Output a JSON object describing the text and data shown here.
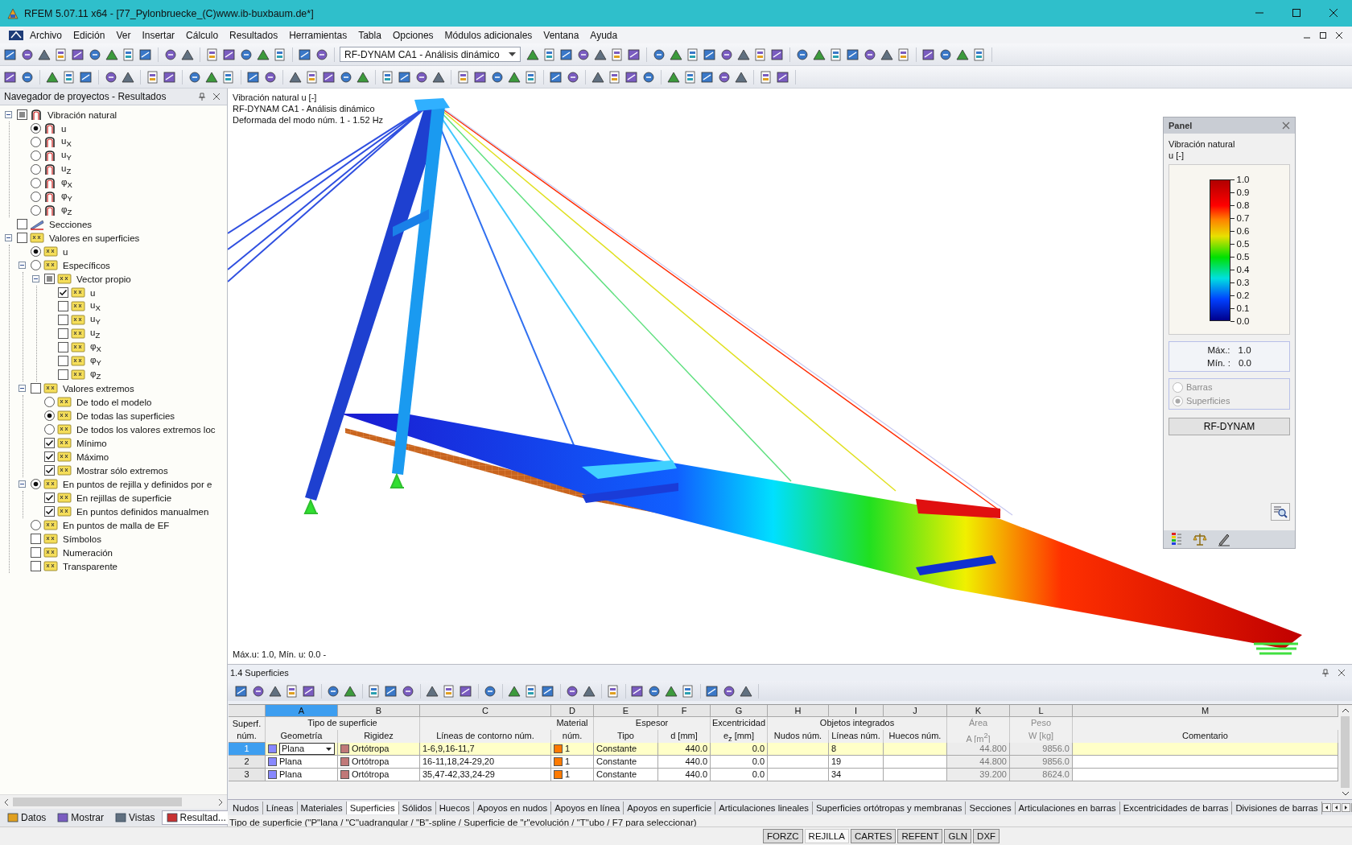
{
  "window": {
    "title": "RFEM 5.07.11 x64 - [77_Pylonbruecke_(C)www.ib-buxbaum.de*]"
  },
  "menu": [
    "Archivo",
    "Edición",
    "Ver",
    "Insertar",
    "Cálculo",
    "Resultados",
    "Herramientas",
    "Tabla",
    "Opciones",
    "Módulos adicionales",
    "Ventana",
    "Ayuda"
  ],
  "toolbar": {
    "load_case": "RF-DYNAM CA1 - Análisis dinámico"
  },
  "navigator": {
    "title": "Navegador de proyectos - Resultados",
    "tree": [
      {
        "label": "Vibración natural",
        "kind": "checkbox",
        "checked": false,
        "partial": true,
        "expanded": true,
        "children": [
          {
            "label": "u",
            "kind": "radio",
            "checked": true
          },
          {
            "label": "u$_{X}$",
            "kind": "radio",
            "checked": false
          },
          {
            "label": "u$_{Y}$",
            "kind": "radio",
            "checked": false
          },
          {
            "label": "u$_{Z}$",
            "kind": "radio",
            "checked": false
          },
          {
            "label": "φ$_{X}$",
            "kind": "radio",
            "checked": false
          },
          {
            "label": "φ$_{Y}$",
            "kind": "radio",
            "checked": false
          },
          {
            "label": "φ$_{Z}$",
            "kind": "radio",
            "checked": false
          }
        ]
      },
      {
        "label": "Secciones",
        "kind": "checkbox",
        "checked": false,
        "partial": false
      },
      {
        "label": "Valores en superficies",
        "kind": "checkbox",
        "checked": false,
        "partial": false,
        "expanded": true,
        "children": [
          {
            "label": "u",
            "kind": "radio",
            "checked": true
          },
          {
            "label": "Específicos",
            "kind": "radio",
            "checked": false,
            "expanded": true,
            "children": [
              {
                "label": "Vector propio",
                "kind": "checkbox",
                "checked": false,
                "partial": true,
                "expanded": true,
                "children": [
                  {
                    "label": "u",
                    "kind": "checkbox",
                    "checked": true,
                    "partial": false
                  },
                  {
                    "label": "u$_{X}$",
                    "kind": "checkbox",
                    "checked": false,
                    "partial": false
                  },
                  {
                    "label": "u$_{Y}$",
                    "kind": "checkbox",
                    "checked": false,
                    "partial": false
                  },
                  {
                    "label": "u$_{Z}$",
                    "kind": "checkbox",
                    "checked": false,
                    "partial": false
                  },
                  {
                    "label": "φ$_{X}$",
                    "kind": "checkbox",
                    "checked": false,
                    "partial": false
                  },
                  {
                    "label": "φ$_{Y}$",
                    "kind": "checkbox",
                    "checked": false,
                    "partial": false
                  },
                  {
                    "label": "φ$_{Z}$",
                    "kind": "checkbox",
                    "checked": false,
                    "partial": false
                  }
                ]
              }
            ]
          },
          {
            "label": "Valores extremos",
            "kind": "checkbox",
            "checked": false,
            "partial": false,
            "expanded": true,
            "children": [
              {
                "label": "De todo el modelo",
                "kind": "radio",
                "checked": false
              },
              {
                "label": "De todas las superficies",
                "kind": "radio",
                "checked": true
              },
              {
                "label": "De todos los valores extremos loc",
                "kind": "radio",
                "checked": false
              },
              {
                "label": "Mínimo",
                "kind": "checkbox",
                "checked": true,
                "partial": false
              },
              {
                "label": "Máximo",
                "kind": "checkbox",
                "checked": true,
                "partial": false
              },
              {
                "label": "Mostrar sólo extremos",
                "kind": "checkbox",
                "checked": true,
                "partial": false
              }
            ]
          },
          {
            "label": "En puntos de rejilla y definidos por e",
            "kind": "radio",
            "checked": true,
            "expanded": true,
            "children": [
              {
                "label": "En rejillas de superficie",
                "kind": "checkbox",
                "checked": true,
                "partial": false
              },
              {
                "label": "En puntos definidos manualmen",
                "kind": "checkbox",
                "checked": true,
                "partial": false
              }
            ]
          },
          {
            "label": "En puntos de malla de EF",
            "kind": "radio",
            "checked": false
          },
          {
            "label": "Símbolos",
            "kind": "checkbox",
            "checked": false,
            "partial": false
          },
          {
            "label": "Numeración",
            "kind": "checkbox",
            "checked": false,
            "partial": false
          },
          {
            "label": "Transparente",
            "kind": "checkbox",
            "checked": false,
            "partial": false
          }
        ]
      }
    ],
    "tabs": [
      {
        "label": "Datos",
        "selected": false
      },
      {
        "label": "Mostrar",
        "selected": false
      },
      {
        "label": "Vistas",
        "selected": false
      },
      {
        "label": "Resultad...",
        "selected": true
      }
    ]
  },
  "viewport": {
    "info": [
      "Vibración natural  u [-]",
      "RF-DYNAM CA1 - Análisis dinámico",
      "Deformada del modo núm. 1 - 1.52 Hz"
    ],
    "footer": "Máx.u: 1.0, Mín. u: 0.0 -"
  },
  "panel": {
    "title": "Panel",
    "heading": "Vibración natural",
    "unit": "u [-]",
    "legend": [
      "1.0",
      "0.9",
      "0.8",
      "0.7",
      "0.6",
      "0.5",
      "0.5",
      "0.4",
      "0.3",
      "0.2",
      "0.1",
      "0.0"
    ],
    "max_label": "Máx.:",
    "max": "1.0",
    "min_label": "Mín. :",
    "min": "0.0",
    "options": [
      {
        "label": "Barras",
        "selected": false
      },
      {
        "label": "Superficies",
        "selected": true
      }
    ],
    "options_disabled": true,
    "button": "RF-DYNAM"
  },
  "table": {
    "title": "1.4 Superficies",
    "corner": [
      "Superf.",
      "núm."
    ],
    "header": [
      {
        "label": "Tipo de superficie",
        "columns": [
          {
            "letter": "A",
            "label": "Geometría",
            "selected": true,
            "greyed": false
          },
          {
            "letter": "B",
            "label": "Rigidez",
            "selected": false,
            "greyed": false
          }
        ]
      },
      {
        "columns": [
          {
            "letter": "C",
            "label": "Líneas de contorno núm.",
            "selected": false,
            "greyed": false
          }
        ]
      },
      {
        "label": "Material",
        "columns": [
          {
            "letter": "D",
            "label": "núm.",
            "selected": false,
            "greyed": false
          }
        ]
      },
      {
        "label": "Espesor",
        "columns": [
          {
            "letter": "E",
            "label": "Tipo",
            "selected": false,
            "greyed": false
          },
          {
            "letter": "F",
            "label": "d [mm]",
            "selected": false,
            "greyed": false
          }
        ]
      },
      {
        "label": "Excentricidad",
        "columns": [
          {
            "letter": "G",
            "label": "e$_{z}$ [mm]",
            "selected": false,
            "greyed": false
          }
        ]
      },
      {
        "label": "Objetos integrados",
        "columns": [
          {
            "letter": "H",
            "label": "Nudos núm.",
            "selected": false,
            "greyed": false
          },
          {
            "letter": "I",
            "label": "Líneas núm.",
            "selected": false,
            "greyed": false
          },
          {
            "letter": "J",
            "label": "Huecos núm.",
            "selected": false,
            "greyed": false
          }
        ]
      },
      {
        "label": "Área",
        "columns": [
          {
            "letter": "K",
            "label": "A [m$^{2}$]",
            "selected": false,
            "greyed": true
          }
        ]
      },
      {
        "label": "Peso",
        "columns": [
          {
            "letter": "L",
            "label": "W [kg]",
            "selected": false,
            "greyed": true
          }
        ]
      },
      {
        "columns": [
          {
            "letter": "M",
            "label": "Comentario",
            "selected": false,
            "greyed": false
          }
        ]
      }
    ],
    "rows": [
      {
        "num": "1",
        "selected": true,
        "cells": {
          "A": "Plana",
          "B": "Ortótropa",
          "C": "1-6,9,16-11,7",
          "D": "1",
          "E": "Constante",
          "F": "440.0",
          "G": "0.0",
          "I": "8",
          "K": "44.800",
          "L": "9856.0"
        }
      },
      {
        "num": "2",
        "selected": false,
        "cells": {
          "A": "Plana",
          "B": "Ortótropa",
          "C": "16-11,18,24-29,20",
          "D": "1",
          "E": "Constante",
          "F": "440.0",
          "G": "0.0",
          "I": "19",
          "K": "44.800",
          "L": "9856.0"
        }
      },
      {
        "num": "3",
        "selected": false,
        "cells": {
          "A": "Plana",
          "B": "Ortótropa",
          "C": "35,47-42,33,24-29",
          "D": "1",
          "E": "Constante",
          "F": "440.0",
          "G": "0.0",
          "I": "34",
          "K": "39.200",
          "L": "8624.0"
        }
      }
    ]
  },
  "sheet_tabs": [
    {
      "label": "Nudos",
      "selected": false
    },
    {
      "label": "Líneas",
      "selected": false
    },
    {
      "label": "Materiales",
      "selected": false
    },
    {
      "label": "Superficies",
      "selected": true
    },
    {
      "label": "Sólidos",
      "selected": false
    },
    {
      "label": "Huecos",
      "selected": false
    },
    {
      "label": "Apoyos en nudos",
      "selected": false
    },
    {
      "label": "Apoyos en línea",
      "selected": false
    },
    {
      "label": "Apoyos en superficie",
      "selected": false
    },
    {
      "label": "Articulaciones lineales",
      "selected": false
    },
    {
      "label": "Superficies ortótropas y membranas",
      "selected": false
    },
    {
      "label": "Secciones",
      "selected": false
    },
    {
      "label": "Articulaciones en barras",
      "selected": false
    },
    {
      "label": "Excentricidades de barras",
      "selected": false
    },
    {
      "label": "Divisiones de barras",
      "selected": false
    }
  ],
  "hint": "Tipo de superficie (\"P\"lana / \"C\"uadrangular / \"B\"-spline / Superficie de \"r\"evolución  / \"T\"ubo / F7 para seleccionar)",
  "status_buttons": [
    {
      "label": "FORZC",
      "on": false
    },
    {
      "label": "REJILLA",
      "on": true
    },
    {
      "label": "CARTES",
      "on": false
    },
    {
      "label": "REFENT",
      "on": false
    },
    {
      "label": "GLN",
      "on": false
    },
    {
      "label": "DXF",
      "on": false
    }
  ]
}
